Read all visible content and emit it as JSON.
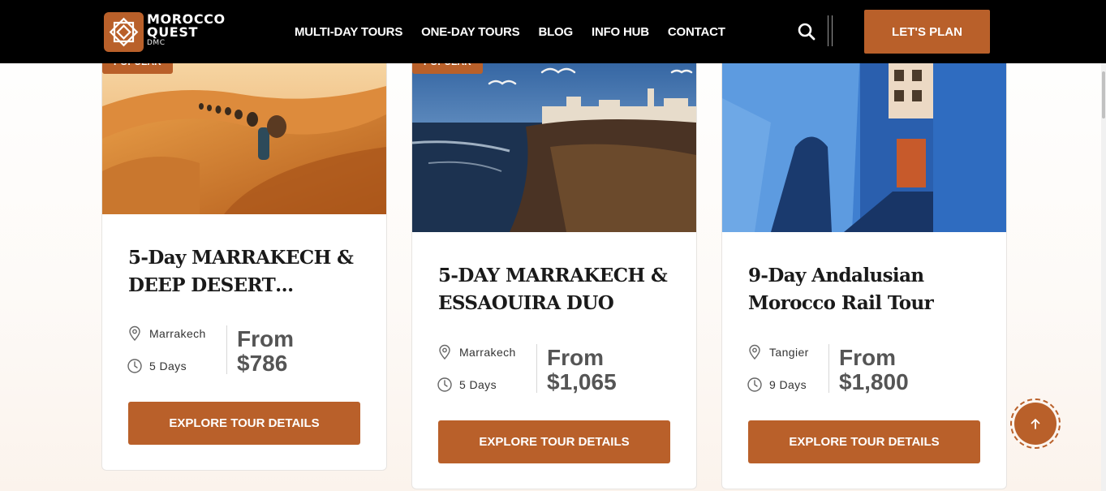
{
  "brand": {
    "line1": "MOROCCO",
    "line2": "QUEST",
    "sub": "DMC",
    "accent": "#b9602a"
  },
  "nav": {
    "items": [
      "MULTI-DAY TOURS",
      "ONE-DAY TOURS",
      "BLOG",
      "INFO HUB",
      "CONTACT"
    ]
  },
  "header": {
    "cta_label": "LET'S PLAN",
    "search_icon": "search-icon"
  },
  "cards": [
    {
      "badge": "POPULAR",
      "title_line1": "5-Day MARRAKECH &",
      "title_line2": "DEEP DESERT…",
      "location": "Marrakech",
      "duration": "5 Days",
      "price_from": "From",
      "price": "$786",
      "button": "EXPLORE TOUR DETAILS"
    },
    {
      "badge": "POPULAR",
      "title_line1": "5-DAY MARRAKECH &",
      "title_line2": "ESSAOUIRA DUO",
      "location": "Marrakech",
      "duration": "5 Days",
      "price_from": "From",
      "price": "$1,065",
      "button": "EXPLORE TOUR DETAILS"
    },
    {
      "badge": "",
      "title_line1": "9-Day Andalusian",
      "title_line2": "Morocco Rail Tour",
      "location": "Tangier",
      "duration": "9 Days",
      "price_from": "From",
      "price": "$1,800",
      "button": "EXPLORE TOUR DETAILS"
    }
  ],
  "scroll_top_icon": "arrow-up-icon"
}
